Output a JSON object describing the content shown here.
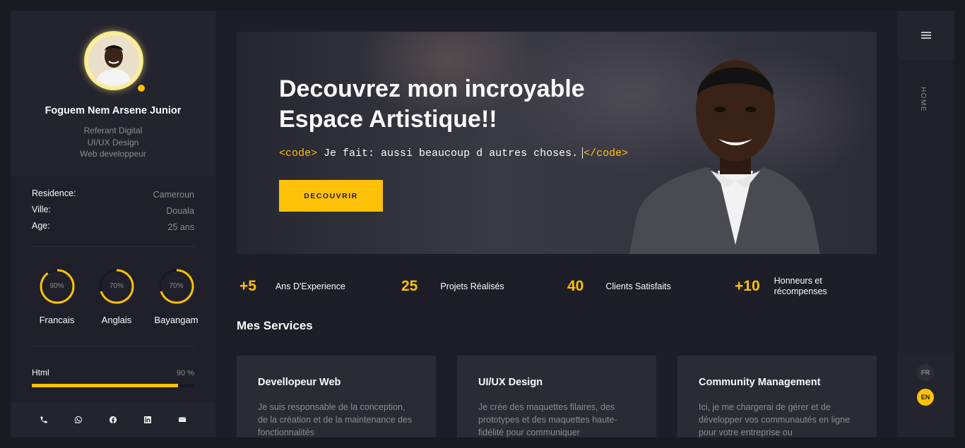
{
  "profile": {
    "name": "Foguem Nem Arsene Junior",
    "roles": [
      "Referant Digital",
      "UI/UX Design",
      "Web developpeur"
    ]
  },
  "info": [
    {
      "label": "Residence:",
      "value": "Cameroun"
    },
    {
      "label": "Ville:",
      "value": "Douala"
    },
    {
      "label": "Age:",
      "value": "25 ans"
    }
  ],
  "languages": [
    {
      "name": "Francais",
      "percent_label": "90%",
      "percent": 90
    },
    {
      "name": "Anglais",
      "percent_label": "70%",
      "percent": 70
    },
    {
      "name": "Bayangam",
      "percent_label": "70%",
      "percent": 70
    }
  ],
  "skills": [
    {
      "name": "Html",
      "percent_label": "90 %",
      "percent": 90
    }
  ],
  "social": [
    "phone-icon",
    "whatsapp-icon",
    "facebook-icon",
    "linkedin-icon",
    "mail-icon"
  ],
  "hero": {
    "title_line1": "Decouvrez mon incroyable",
    "title_line2": "Espace Artistique!!",
    "code_open": "<code>",
    "code_text": "Je fait: aussi beaucoup d autres choses.",
    "code_close": "</code>",
    "button_label": "DECOUVRIR"
  },
  "counters": [
    {
      "number": "+5",
      "label_line1": "Ans D'Experience",
      "label_line2": ""
    },
    {
      "number": "25",
      "label_line1": "Projets Réalisés",
      "label_line2": ""
    },
    {
      "number": "40",
      "label_line1": "Clients Satisfaits",
      "label_line2": ""
    },
    {
      "number": "+10",
      "label_line1": "Honneurs et",
      "label_line2": "récompenses"
    }
  ],
  "services": {
    "title": "Mes Services",
    "cards": [
      {
        "title": "Devellopeur Web",
        "text": "Je suis responsable de la conception, de la création et de la maintenance des fonctionnalités"
      },
      {
        "title": "UI/UX Design",
        "text": "Je crée des maquettes filaires, des prototypes et des maquettes haute-fidélité pour communiquer"
      },
      {
        "title": "Community Management",
        "text": "Ici, je me chargerai de gérer et de développer vos communautés en ligne pour votre entreprise ou"
      }
    ]
  },
  "rail": {
    "menu_icon": "menu-icon",
    "current_section": "HOME",
    "lang_fr": "FR",
    "lang_en": "EN"
  },
  "colors": {
    "accent": "#ffc107",
    "background": "#1e1e28",
    "panel": "#20202a",
    "card": "#2b2b36",
    "muted_text": "#8c8c8e"
  }
}
